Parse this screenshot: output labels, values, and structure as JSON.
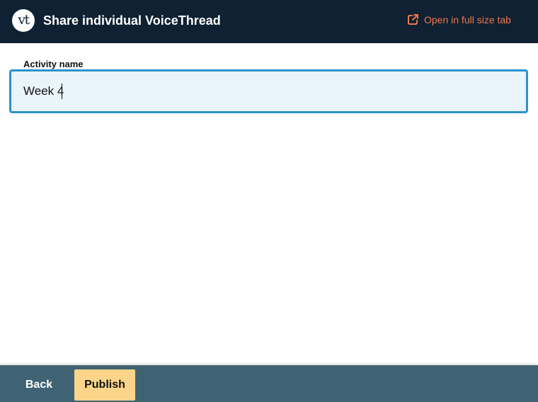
{
  "header": {
    "logo_text": "vt",
    "title": "Share individual VoiceThread",
    "open_tab_label": "Open in full size tab",
    "open_tab_icon": "external-link-icon"
  },
  "form": {
    "activity_name_label": "Activity name",
    "activity_name_value": "Week 4"
  },
  "footer": {
    "back_label": "Back",
    "publish_label": "Publish"
  },
  "colors": {
    "header_bg": "#0f2132",
    "accent_link": "#f0784a",
    "input_border": "#2a93cc",
    "input_bg": "#e9f4fb",
    "footer_bg": "#3f6373",
    "publish_bg": "#fcd58a"
  }
}
